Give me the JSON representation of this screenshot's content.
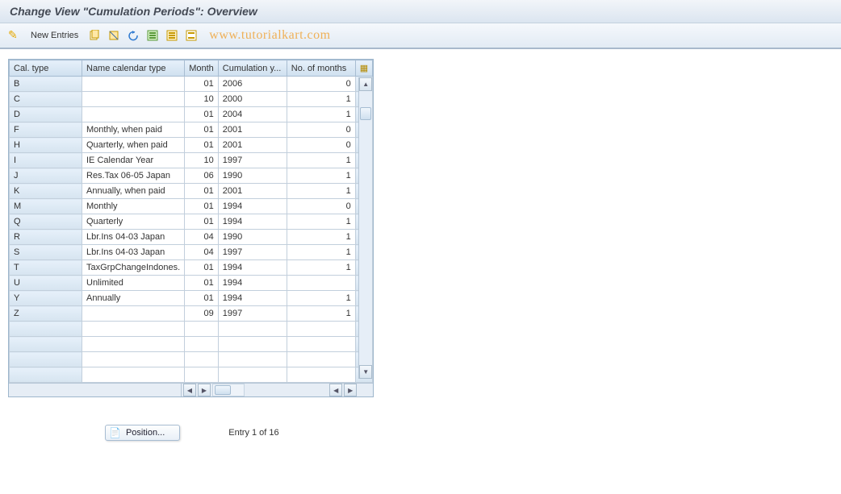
{
  "header": {
    "title": "Change View \"Cumulation Periods\": Overview"
  },
  "toolbar": {
    "new_entries_label": "New Entries",
    "watermark": "www.tutorialkart.com"
  },
  "grid": {
    "columns": {
      "cal_type": "Cal. type",
      "name": "Name calendar type",
      "month": "Month",
      "cumulation": "Cumulation y...",
      "no_months": "No. of months"
    },
    "rows": [
      {
        "cal": "B",
        "name": "",
        "month": "01",
        "cum": "2006",
        "num": "0"
      },
      {
        "cal": "C",
        "name": "",
        "month": "10",
        "cum": "2000",
        "num": "1"
      },
      {
        "cal": "D",
        "name": "",
        "month": "01",
        "cum": "2004",
        "num": "1"
      },
      {
        "cal": "F",
        "name": "Monthly, when paid",
        "month": "01",
        "cum": "2001",
        "num": "0"
      },
      {
        "cal": "H",
        "name": "Quarterly, when paid",
        "month": "01",
        "cum": "2001",
        "num": "0"
      },
      {
        "cal": "I",
        "name": "IE Calendar Year",
        "month": "10",
        "cum": "1997",
        "num": "1"
      },
      {
        "cal": "J",
        "name": "Res.Tax 06-05  Japan",
        "month": "06",
        "cum": "1990",
        "num": "1"
      },
      {
        "cal": "K",
        "name": "Annually, when paid",
        "month": "01",
        "cum": "2001",
        "num": "1"
      },
      {
        "cal": "M",
        "name": "Monthly",
        "month": "01",
        "cum": "1994",
        "num": "0"
      },
      {
        "cal": "Q",
        "name": "Quarterly",
        "month": "01",
        "cum": "1994",
        "num": "1"
      },
      {
        "cal": "R",
        "name": "Lbr.Ins 04-03  Japan",
        "month": "04",
        "cum": "1990",
        "num": "1"
      },
      {
        "cal": "S",
        "name": "Lbr.Ins 04-03  Japan",
        "month": "04",
        "cum": "1997",
        "num": "1"
      },
      {
        "cal": "T",
        "name": "TaxGrpChangeIndones.",
        "month": "01",
        "cum": "1994",
        "num": "1"
      },
      {
        "cal": "U",
        "name": "Unlimited",
        "month": "01",
        "cum": "1994",
        "num": ""
      },
      {
        "cal": "Y",
        "name": "Annually",
        "month": "01",
        "cum": "1994",
        "num": "1"
      },
      {
        "cal": "Z",
        "name": "",
        "month": "09",
        "cum": "1997",
        "num": "1"
      },
      {
        "cal": "",
        "name": "",
        "month": "",
        "cum": "",
        "num": ""
      },
      {
        "cal": "",
        "name": "",
        "month": "",
        "cum": "",
        "num": ""
      },
      {
        "cal": "",
        "name": "",
        "month": "",
        "cum": "",
        "num": ""
      },
      {
        "cal": "",
        "name": "",
        "month": "",
        "cum": "",
        "num": ""
      }
    ]
  },
  "footer": {
    "position_label": "Position...",
    "entry_text": "Entry 1 of 16"
  }
}
